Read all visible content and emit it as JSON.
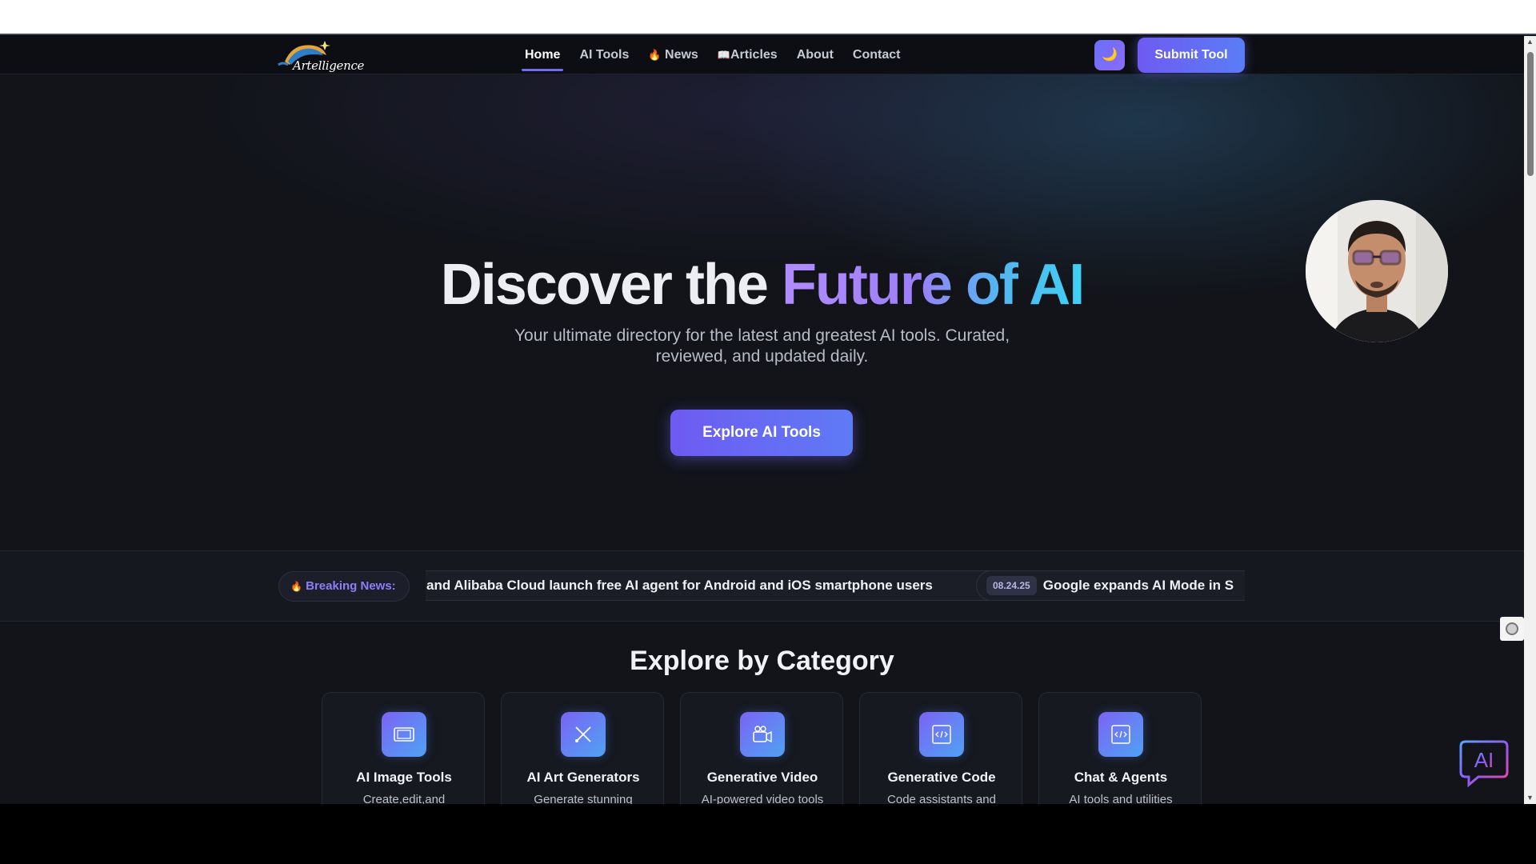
{
  "header": {
    "logo_text": "Artelligence",
    "nav": [
      {
        "label": "Home",
        "icon": ""
      },
      {
        "label": "AI Tools",
        "icon": ""
      },
      {
        "label": "News",
        "icon": "fire-icon"
      },
      {
        "label": "Articles",
        "icon": "book-icon"
      },
      {
        "label": "About",
        "icon": ""
      },
      {
        "label": "Contact",
        "icon": ""
      }
    ],
    "theme_toggle_icon": "🌙",
    "submit_label": "Submit Tool"
  },
  "hero": {
    "title_plain": "Discover the ",
    "title_gradient": "Future of AI",
    "subtitle": "Your ultimate directory for the latest and greatest AI tools. Curated, reviewed, and updated daily.",
    "cta_label": "Explore AI Tools"
  },
  "ticker": {
    "label": "Breaking News:",
    "items": [
      {
        "date": "",
        "text": "and Alibaba Cloud launch free AI agent for Android and iOS smartphone users"
      },
      {
        "date": "08.24.25",
        "text": "Google expands AI Mode in S"
      }
    ]
  },
  "categories": {
    "title": "Explore by Category",
    "items": [
      {
        "name": "AI Image Tools",
        "desc": "Create,edit,and enhance images",
        "icon": "image-icon"
      },
      {
        "name": "AI Art Generators",
        "desc": "Generate stunning visuals",
        "icon": "brush-icon"
      },
      {
        "name": "Generative Video",
        "desc": "AI-powered video tools",
        "icon": "video-camera-icon"
      },
      {
        "name": "Generative Code",
        "desc": "Code assistants and tools",
        "icon": "code-icon"
      },
      {
        "name": "Chat & Agents",
        "desc": "AI tools and utilities",
        "icon": "code-icon"
      }
    ]
  },
  "chat_widget_label": "AI",
  "colors": {
    "accent": "#6e5bf2",
    "background": "#12141a",
    "gradient_start": "#b28cff",
    "gradient_end": "#3ed1f2"
  }
}
